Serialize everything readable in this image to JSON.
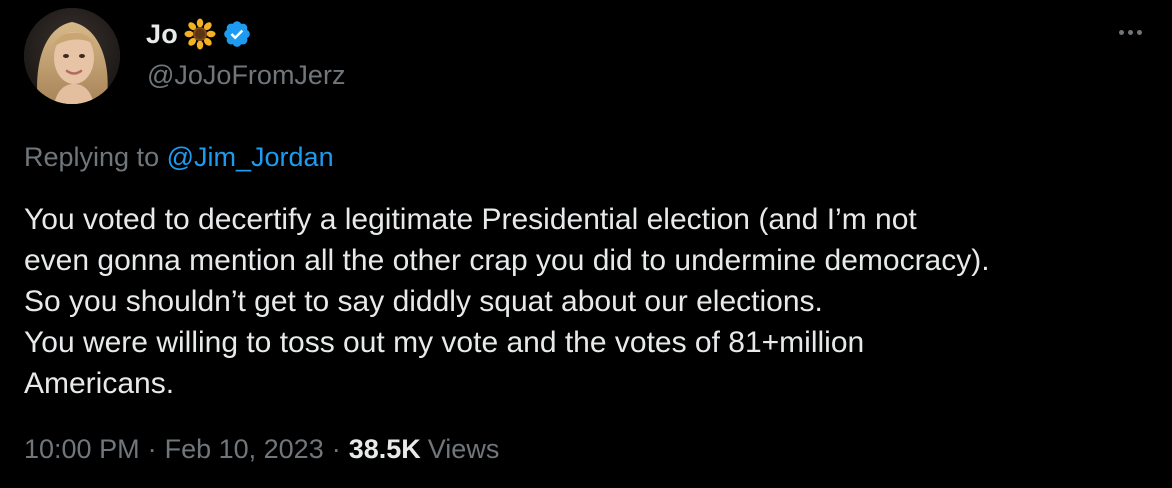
{
  "author": {
    "display_name": "Jo",
    "name_emoji": "sunflower-icon",
    "verified": true,
    "handle": "@JoJoFromJerz"
  },
  "reply": {
    "prefix": "Replying to",
    "mention": "@Jim_Jordan"
  },
  "tweet": {
    "text": "You voted to decertify a legitimate Presidential election (and I’m not\neven gonna mention all the other crap you did to undermine democracy).\nSo you shouldn’t get to say diddly squat about our elections.\nYou were willing to toss out my vote and the votes of 81+million\nAmericans."
  },
  "meta": {
    "time": "10:00 PM",
    "separator": "·",
    "date": "Feb 10, 2023",
    "views_count": "38.5K",
    "views_label": "Views"
  },
  "colors": {
    "background": "#000000",
    "text_primary": "#e7e9ea",
    "text_secondary": "#71767b",
    "accent": "#1d9bf0"
  }
}
